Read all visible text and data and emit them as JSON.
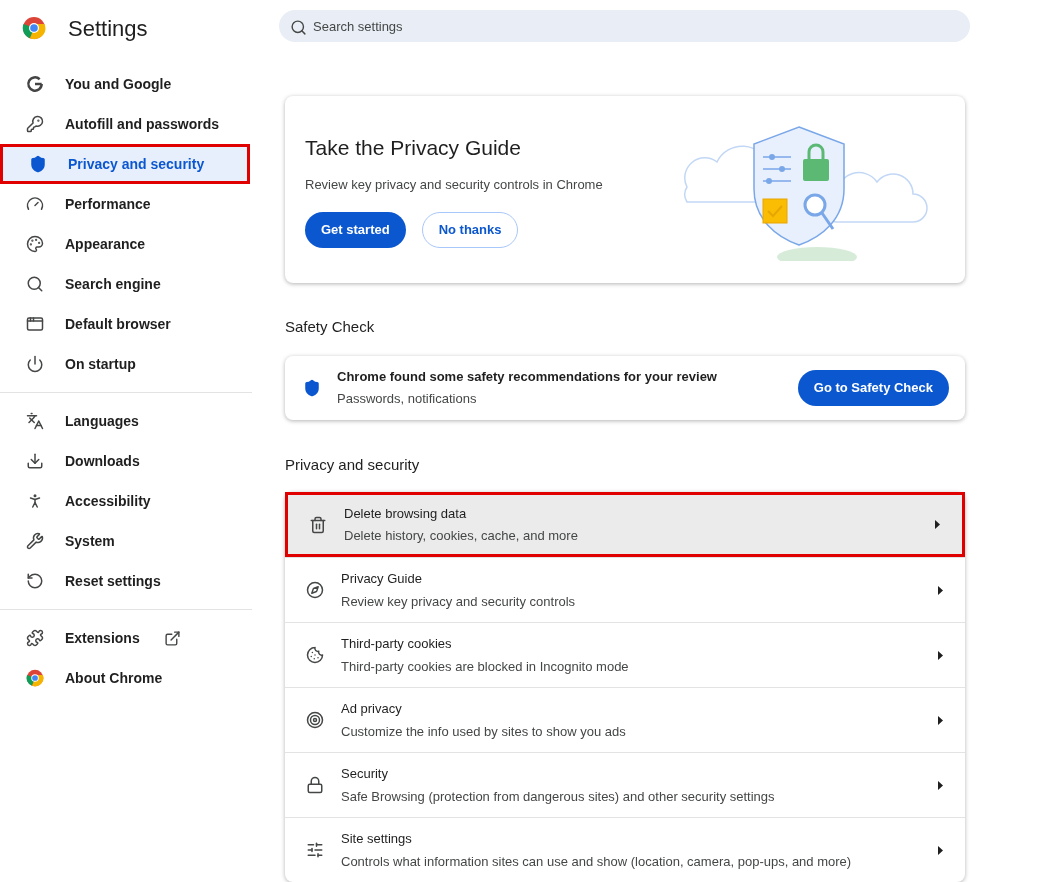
{
  "header": {
    "title": "Settings"
  },
  "search": {
    "placeholder": "Search settings"
  },
  "sidebar": {
    "groups": [
      {
        "items": [
          {
            "label": "You and Google",
            "kind": "google",
            "selected": false,
            "annotated": false
          },
          {
            "label": "Autofill and passwords",
            "kind": "key",
            "selected": false,
            "annotated": false
          },
          {
            "label": "Privacy and security",
            "kind": "shield",
            "selected": true,
            "annotated": true
          },
          {
            "label": "Performance",
            "kind": "gauge",
            "selected": false,
            "annotated": false
          },
          {
            "label": "Appearance",
            "kind": "palette",
            "selected": false,
            "annotated": false
          },
          {
            "label": "Search engine",
            "kind": "search",
            "selected": false,
            "annotated": false
          },
          {
            "label": "Default browser",
            "kind": "browser",
            "selected": false,
            "annotated": false
          },
          {
            "label": "On startup",
            "kind": "power",
            "selected": false,
            "annotated": false
          }
        ]
      },
      {
        "items": [
          {
            "label": "Languages",
            "kind": "languages",
            "selected": false,
            "annotated": false
          },
          {
            "label": "Downloads",
            "kind": "download",
            "selected": false,
            "annotated": false
          },
          {
            "label": "Accessibility",
            "kind": "accessibility",
            "selected": false,
            "annotated": false
          },
          {
            "label": "System",
            "kind": "wrench",
            "selected": false,
            "annotated": false
          },
          {
            "label": "Reset settings",
            "kind": "reset",
            "selected": false,
            "annotated": false
          }
        ]
      },
      {
        "items": [
          {
            "label": "Extensions",
            "kind": "puzzle",
            "external": true,
            "selected": false,
            "annotated": false
          },
          {
            "label": "About Chrome",
            "kind": "chrome",
            "external": false,
            "selected": false,
            "annotated": false
          }
        ]
      }
    ]
  },
  "privacy_guide": {
    "title": "Take the Privacy Guide",
    "description": "Review key privacy and security controls in Chrome",
    "buttons": [
      {
        "label": "Get started",
        "kind": "primary"
      },
      {
        "label": "No thanks",
        "kind": "outline"
      }
    ]
  },
  "safety_check": {
    "heading": "Safety Check",
    "title": "Chrome found some safety recommendations for your review",
    "subtitle": "Passwords, notifications",
    "button": "Go to Safety Check"
  },
  "privacy_section": {
    "heading": "Privacy and security",
    "rows": [
      {
        "kind": "trash",
        "title": "Delete browsing data",
        "subtitle": "Delete history, cookies, cache, and more",
        "annotated": true
      },
      {
        "kind": "compass",
        "title": "Privacy Guide",
        "subtitle": "Review key privacy and security controls",
        "annotated": false
      },
      {
        "kind": "cookie",
        "title": "Third-party cookies",
        "subtitle": "Third-party cookies are blocked in Incognito mode",
        "annotated": false
      },
      {
        "kind": "ads",
        "title": "Ad privacy",
        "subtitle": "Customize the info used by sites to show you ads",
        "annotated": false
      },
      {
        "kind": "lock",
        "title": "Security",
        "subtitle": "Safe Browsing (protection from dangerous sites) and other security settings",
        "annotated": false
      },
      {
        "kind": "sliders",
        "title": "Site settings",
        "subtitle": "Controls what information sites can use and show (location, camera, pop-ups, and more)",
        "annotated": false
      }
    ]
  }
}
